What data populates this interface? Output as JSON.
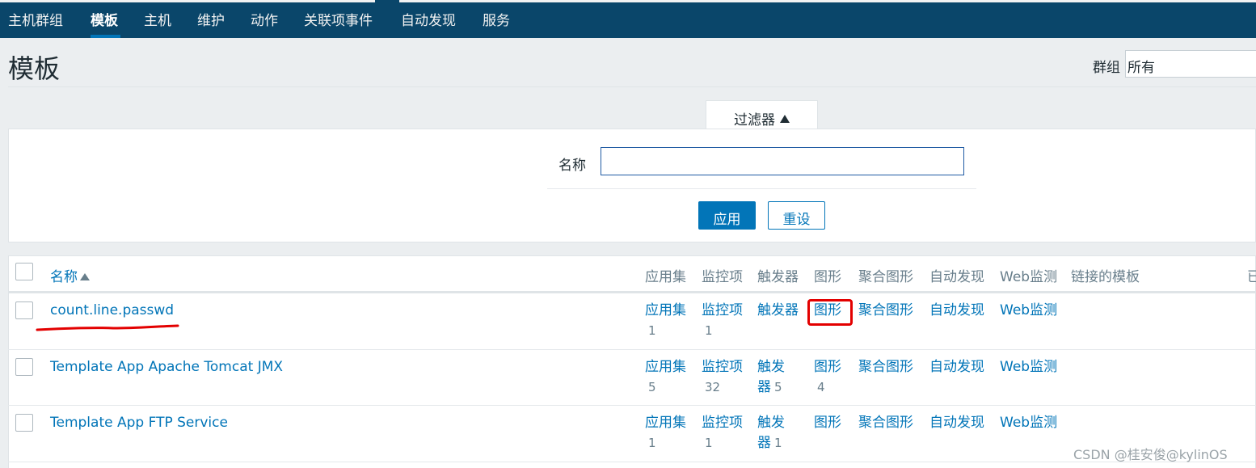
{
  "nav": {
    "items": [
      "主机群组",
      "模板",
      "主机",
      "维护",
      "动作",
      "关联项事件",
      "自动发现",
      "服务"
    ],
    "active": "模板"
  },
  "header": {
    "title": "模板",
    "group_label": "群组",
    "group_value": "所有"
  },
  "filter": {
    "tab_label": "过滤器",
    "name_label": "名称",
    "name_value": "",
    "apply_label": "应用",
    "reset_label": "重设"
  },
  "table": {
    "columns": {
      "name": "名称",
      "applications": "应用集",
      "items": "监控项",
      "triggers": "触发器",
      "graphs": "图形",
      "screens": "聚合图形",
      "discovery": "自动发现",
      "web": "Web监测",
      "linked": "链接的模板",
      "cut": "已"
    },
    "rows": [
      {
        "name": "count.line.passwd",
        "applications": {
          "label": "应用集",
          "count": "1"
        },
        "items": {
          "label": "监控项",
          "count": "1"
        },
        "triggers": {
          "label": "触发器",
          "count": ""
        },
        "graphs": {
          "label": "图形",
          "count": ""
        },
        "screens": "聚合图形",
        "discovery": "自动发现",
        "web": "Web监测"
      },
      {
        "name": "Template App Apache Tomcat JMX",
        "applications": {
          "label": "应用集",
          "count": "5"
        },
        "items": {
          "label": "监控项",
          "count": "32"
        },
        "triggers": {
          "label": "触发器",
          "count": "5"
        },
        "graphs": {
          "label": "图形",
          "count": "4"
        },
        "screens": "聚合图形",
        "discovery": "自动发现",
        "web": "Web监测"
      },
      {
        "name": "Template App FTP Service",
        "applications": {
          "label": "应用集",
          "count": "1"
        },
        "items": {
          "label": "监控项",
          "count": "1"
        },
        "triggers": {
          "label": "触发器",
          "count": "1"
        },
        "graphs": {
          "label": "图形",
          "count": ""
        },
        "screens": "聚合图形",
        "discovery": "自动发现",
        "web": "Web监测"
      }
    ]
  },
  "watermark": "CSDN @桂安俊@kylinOS",
  "colors": {
    "nav_bg": "#0a466a",
    "link": "#0275b8",
    "annotation_red": "#e30000"
  }
}
